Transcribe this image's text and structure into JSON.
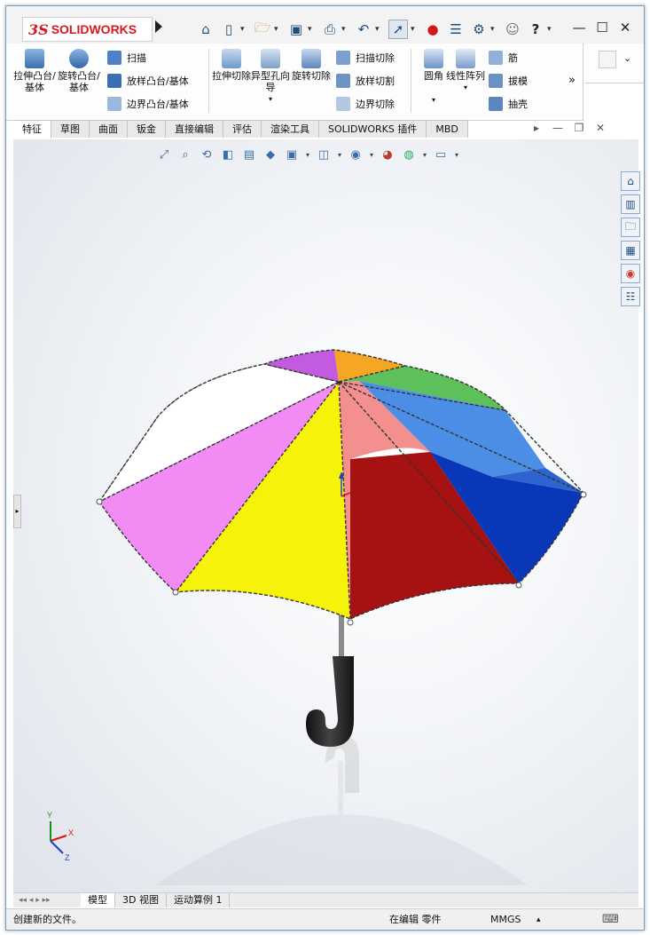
{
  "app": {
    "brand_prefix": "3S",
    "brand_name": "SOLIDWORKS"
  },
  "quick_access": {
    "home_icon": "home-icon",
    "new_icon": "new-document-icon",
    "open_icon": "open-icon",
    "save_icon": "save-icon",
    "print_icon": "print-icon",
    "undo_icon": "undo-icon",
    "select_icon": "select-arrow-icon",
    "rebuild_icon": "traffic-light-icon",
    "file_props_icon": "file-properties-icon",
    "options_icon": "gear-icon",
    "user_icon": "user-icon",
    "help_label": "?"
  },
  "window": {
    "minimize": "—",
    "restore": "☐",
    "close": "✕"
  },
  "ribbon": {
    "extrude_boss": "拉伸凸台/基体",
    "revolve_boss": "旋转凸台/基体",
    "sweep": "扫描",
    "loft_boss": "放样凸台/基体",
    "boundary_boss": "边界凸台/基体",
    "extrude_cut": "拉伸切除",
    "hole_wizard": "异型孔向导",
    "revolve_cut": "旋转切除",
    "swept_cut": "扫描切除",
    "lofted_cut": "放样切割",
    "boundary_cut": "边界切除",
    "fillet": "圆角",
    "linear_pattern": "线性阵列",
    "rib": "筋",
    "draft": "拔模",
    "shell": "抽壳",
    "expand": "»"
  },
  "tabs": [
    "特征",
    "草图",
    "曲面",
    "钣金",
    "直接编辑",
    "评估",
    "渲染工具",
    "SOLIDWORKS 插件",
    "MBD"
  ],
  "active_tab": "特征",
  "bottom_tabs": [
    "模型",
    "3D 视图",
    "运动算例 1"
  ],
  "active_bottom_tab": "模型",
  "status": {
    "message": "创建新的文件。",
    "mode": "在编辑 零件",
    "units": "MMGS",
    "caret": "▴"
  },
  "triad": {
    "x": "X",
    "y": "Y",
    "z": "Z"
  },
  "colors": {
    "yellow": "#f7f20a",
    "magenta": "#f28cf4",
    "white": "#ffffff",
    "purple": "#c25be0",
    "orange": "#f5a623",
    "green": "#5ec05a",
    "lightblue": "#4c8ee6",
    "darkblue": "#0a36b8",
    "red": "#a61111",
    "pink": "#f38f8f",
    "handle": "#2b2b2b"
  }
}
